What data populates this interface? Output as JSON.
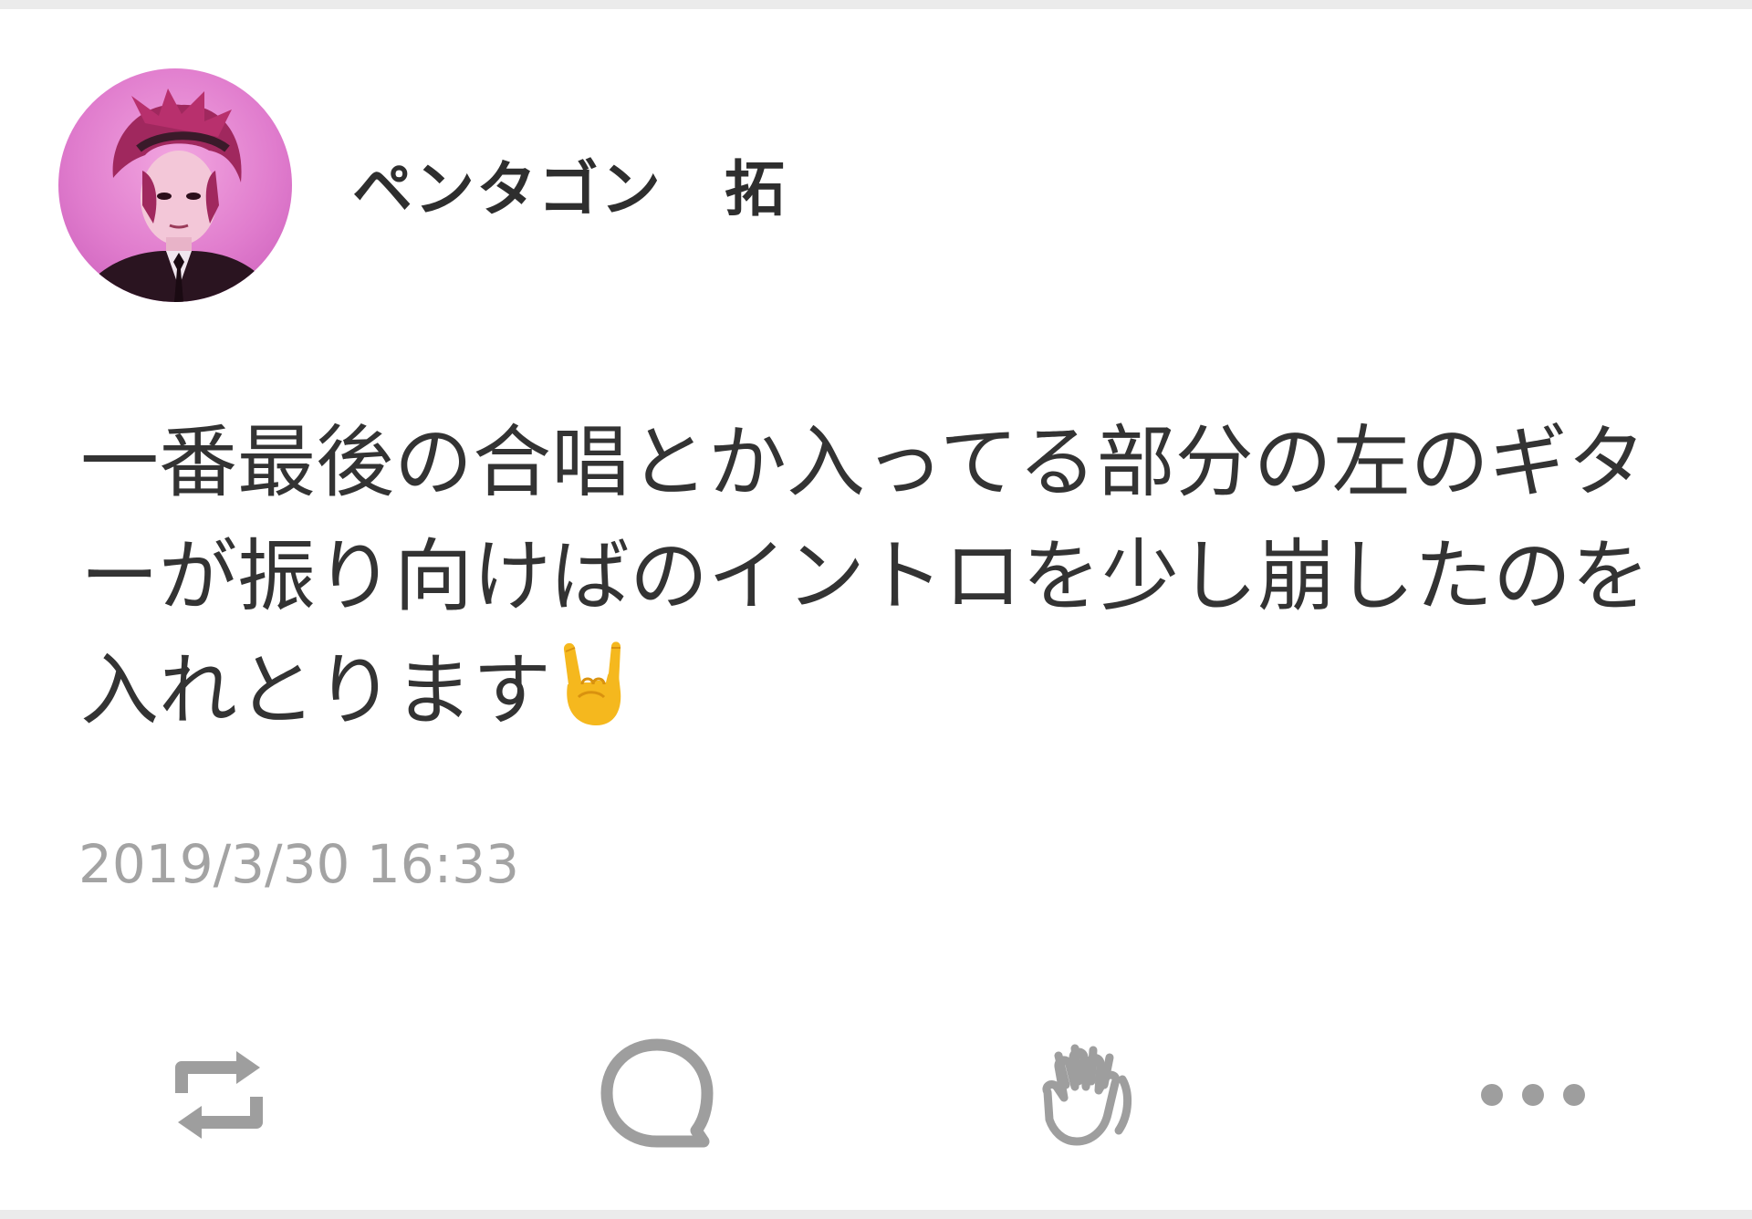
{
  "post": {
    "author": {
      "name": "ペンタゴン　拓",
      "avatar_icon": "avatar-photo"
    },
    "body": {
      "text": "一番最後の合唱とか入ってる部分の左のギターが振り向けばのイントロを少し崩したのを入れとります",
      "emoji": "🤘",
      "emoji_icon": "sign-of-the-horns-emoji"
    },
    "timestamp": "2019/3/30 16:33"
  },
  "actions": [
    {
      "icon": "share-icon"
    },
    {
      "icon": "comment-icon"
    },
    {
      "icon": "cheer-icon"
    },
    {
      "icon": "more-icon"
    }
  ],
  "colors": {
    "text": "#333333",
    "timestamp": "#a3a3a3",
    "icon": "#9e9e9e",
    "divider": "#ebebeb",
    "avatar_bg": "#e07ccd",
    "emoji": "#f5b81e"
  }
}
